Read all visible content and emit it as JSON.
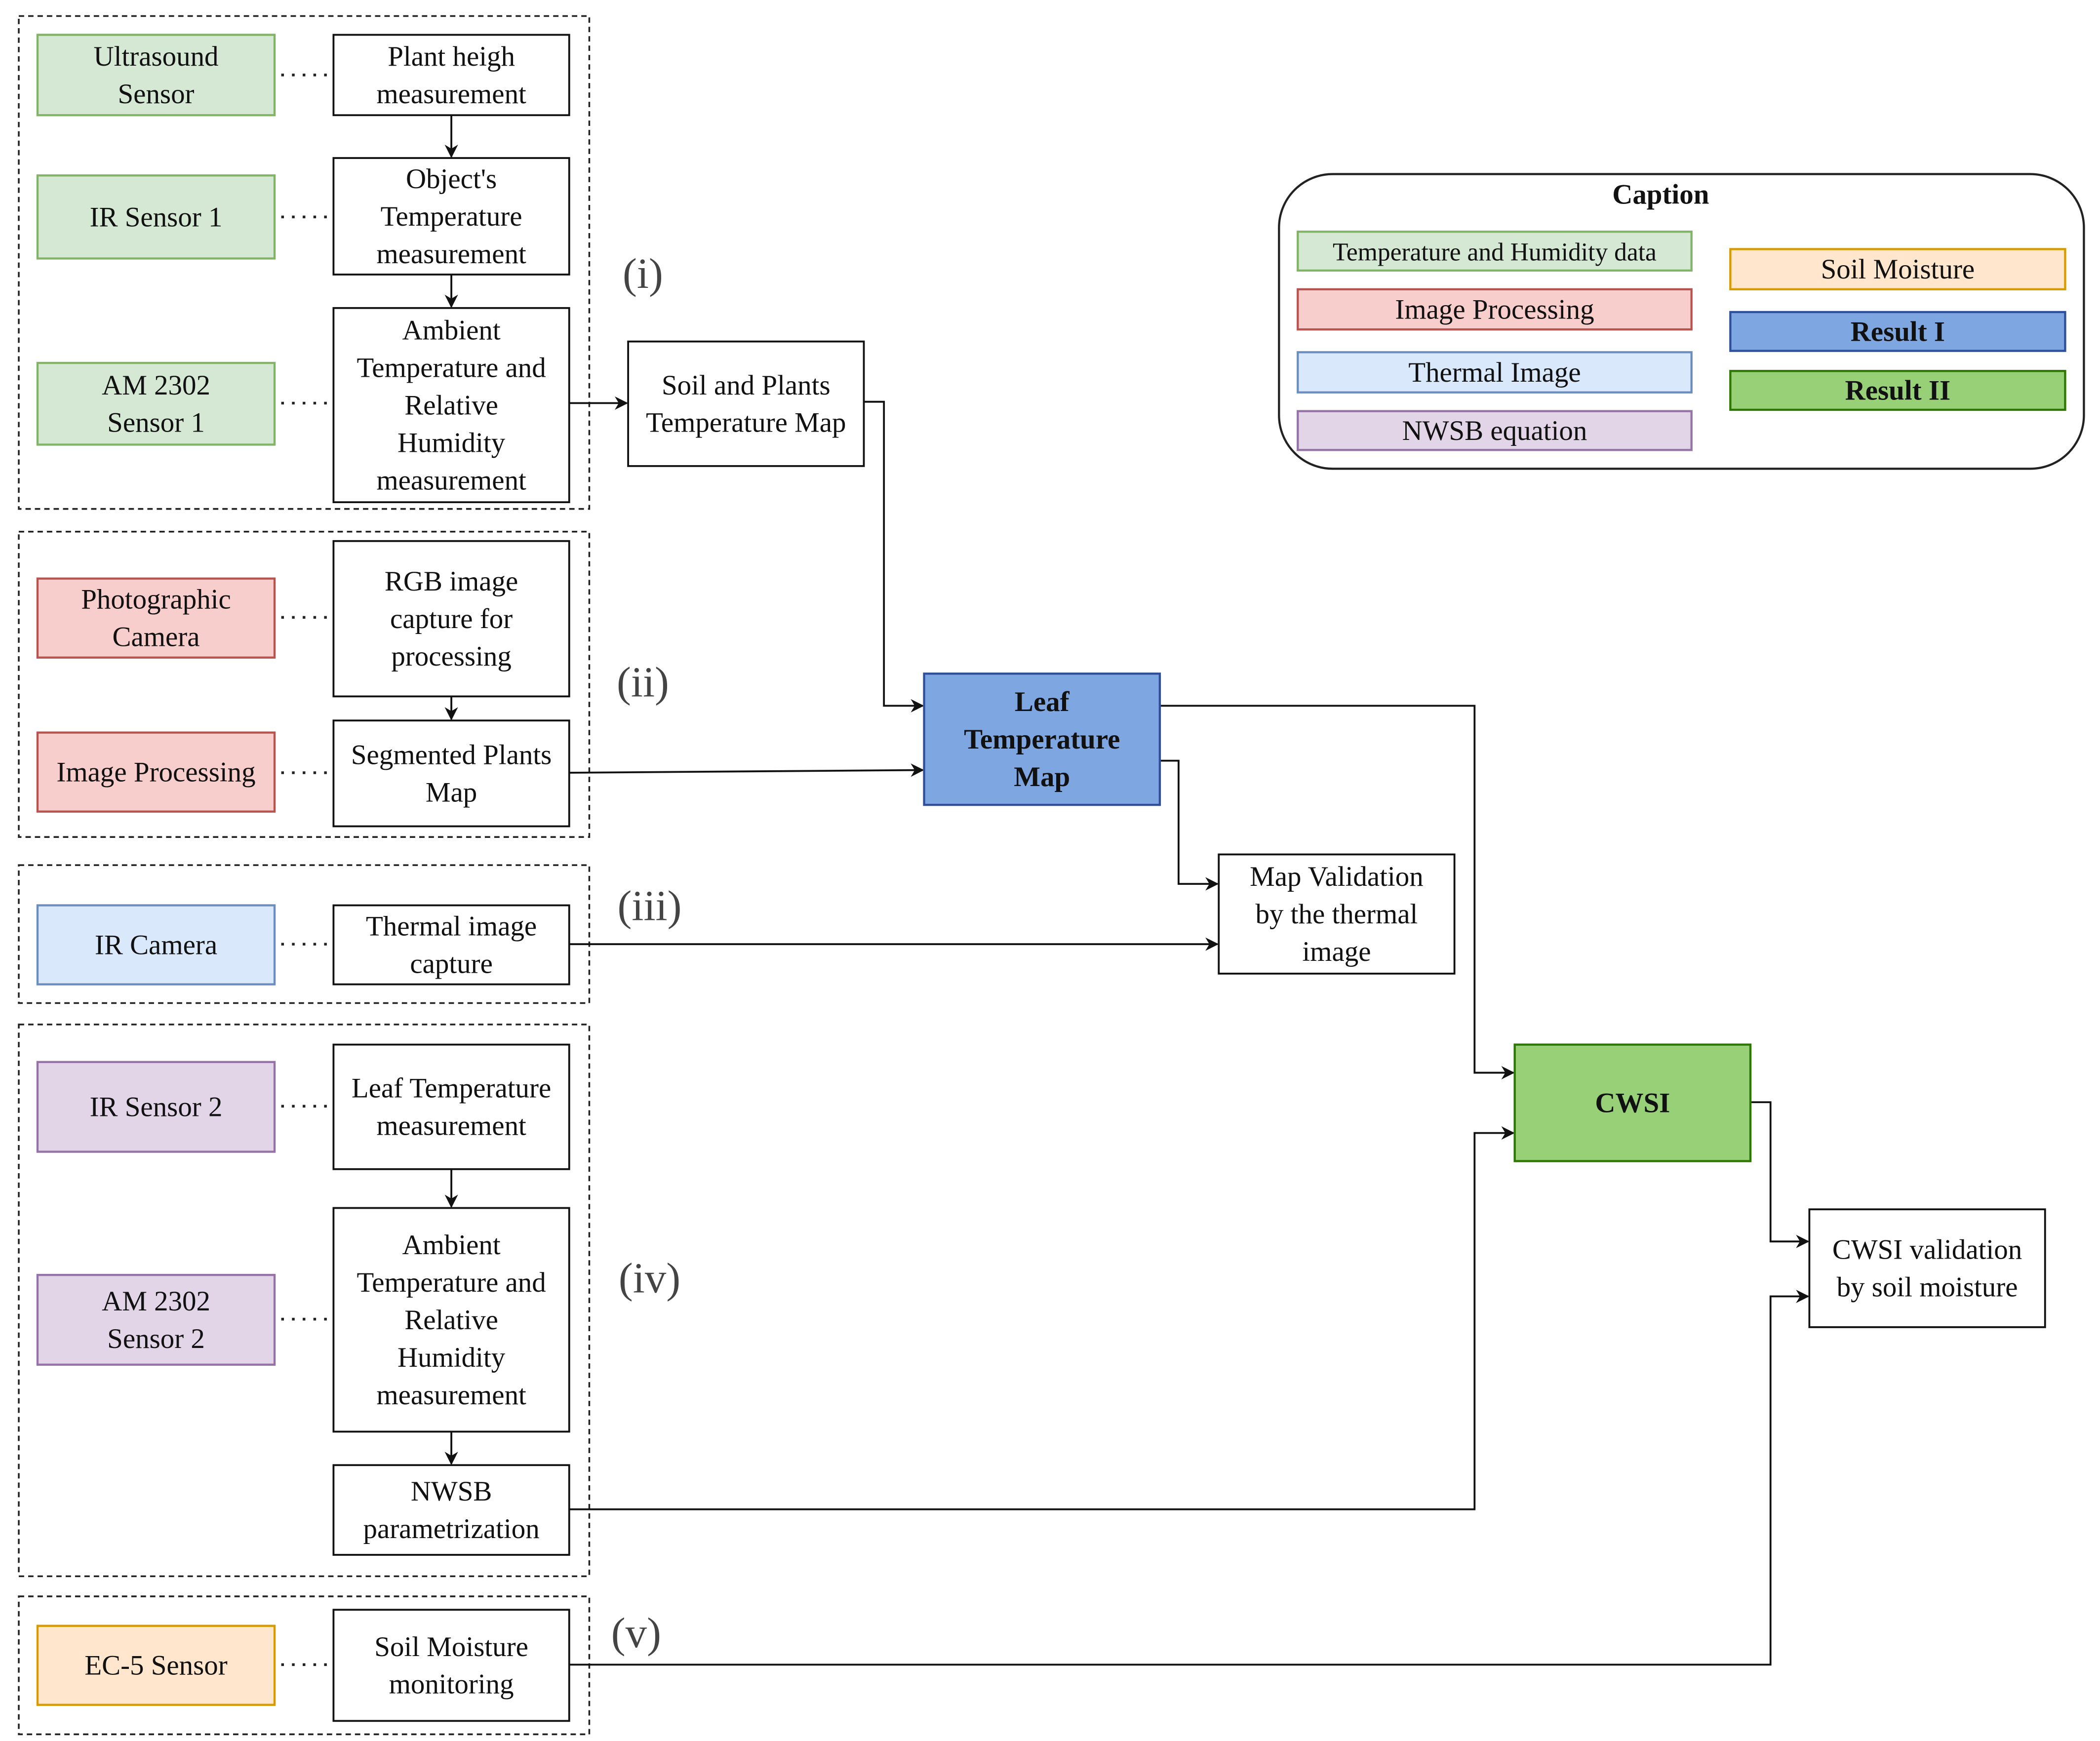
{
  "colors": {
    "temperature_humidity": {
      "fill": "#d5e8d4",
      "stroke": "#82b366"
    },
    "image_processing": {
      "fill": "#f8cecc",
      "stroke": "#b85450"
    },
    "thermal_image": {
      "fill": "#dae8fc",
      "stroke": "#6c8ebf"
    },
    "nwsb_equation": {
      "fill": "#e1d5e7",
      "stroke": "#9673a6"
    },
    "soil_moisture": {
      "fill": "#ffe6cc",
      "stroke": "#d79b00"
    },
    "result_1": {
      "fill": "#7ea6e0",
      "stroke": "#2f4f9a"
    },
    "result_2": {
      "fill": "#97d077",
      "stroke": "#2d7600"
    },
    "plain": {
      "fill": "#ffffff",
      "stroke": "#111111"
    }
  },
  "section_labels": [
    "(i)",
    "(ii)",
    "(iii)",
    "(iv)",
    "(v)"
  ],
  "nodes": {
    "ultrasound": {
      "lines": [
        "Ultrasound",
        "Sensor"
      ],
      "category": "temperature_humidity"
    },
    "ir_sensor_1": {
      "lines": [
        "IR Sensor 1"
      ],
      "category": "temperature_humidity"
    },
    "am2302_1": {
      "lines": [
        "AM 2302",
        "Sensor 1"
      ],
      "category": "temperature_humidity"
    },
    "photo_camera": {
      "lines": [
        "Photographic",
        "Camera"
      ],
      "category": "image_processing"
    },
    "image_processing": {
      "lines": [
        "Image Processing"
      ],
      "category": "image_processing"
    },
    "ir_camera": {
      "lines": [
        "IR Camera"
      ],
      "category": "thermal_image"
    },
    "ir_sensor_2": {
      "lines": [
        "IR Sensor  2"
      ],
      "category": "nwsb_equation"
    },
    "am2302_2": {
      "lines": [
        "AM 2302",
        "Sensor 2"
      ],
      "category": "nwsb_equation"
    },
    "ec5": {
      "lines": [
        "EC-5 Sensor"
      ],
      "category": "soil_moisture"
    },
    "plant_height": {
      "lines": [
        "Plant heigh",
        "measurement"
      ],
      "category": "plain"
    },
    "object_temp": {
      "lines": [
        "Object's",
        "Temperature",
        "measurement"
      ],
      "category": "plain"
    },
    "ambient_1": {
      "lines": [
        "Ambient",
        "Temperature and",
        "Relative",
        "Humidity",
        "measurement"
      ],
      "category": "plain"
    },
    "rgb_capture": {
      "lines": [
        "RGB image",
        "capture for",
        "processing"
      ],
      "category": "plain"
    },
    "segmented": {
      "lines": [
        "Segmented Plants",
        "Map"
      ],
      "category": "plain"
    },
    "thermal_capture": {
      "lines": [
        "Thermal image",
        "capture"
      ],
      "category": "plain"
    },
    "leaf_temp_meas": {
      "lines": [
        "Leaf  Temperature",
        "measurement"
      ],
      "category": "plain"
    },
    "ambient_2": {
      "lines": [
        "Ambient",
        "Temperature and",
        "Relative",
        "Humidity",
        "measurement"
      ],
      "category": "plain"
    },
    "nwsb_param": {
      "lines": [
        "NWSB",
        "parametrization"
      ],
      "category": "plain"
    },
    "soil_monitoring": {
      "lines": [
        "Soil Moisture",
        "monitoring"
      ],
      "category": "plain"
    },
    "soil_plants_map": {
      "lines": [
        "Soil and Plants",
        "Temperature Map"
      ],
      "category": "plain"
    },
    "leaf_temp_map": {
      "lines": [
        "Leaf",
        "Temperature",
        "Map"
      ],
      "category": "result_1",
      "bold": true
    },
    "map_validation": {
      "lines": [
        "Map Validation",
        "by the thermal",
        "image"
      ],
      "category": "plain"
    },
    "cwsi": {
      "lines": [
        "CWSI"
      ],
      "category": "result_2",
      "bold": true
    },
    "cwsi_validation": {
      "lines": [
        "CWSI validation",
        "by soil moisture"
      ],
      "category": "plain"
    }
  },
  "caption": {
    "title": "Caption",
    "items": [
      {
        "label": "Temperature and Humidity data",
        "category": "temperature_humidity"
      },
      {
        "label": "Image Processing",
        "category": "image_processing"
      },
      {
        "label": "Thermal Image",
        "category": "thermal_image"
      },
      {
        "label": "NWSB equation",
        "category": "nwsb_equation"
      },
      {
        "label": "Soil Moisture",
        "category": "soil_moisture"
      },
      {
        "label": "Result I",
        "category": "result_1",
        "bold": true
      },
      {
        "label": "Result II",
        "category": "result_2",
        "bold": true
      }
    ]
  }
}
